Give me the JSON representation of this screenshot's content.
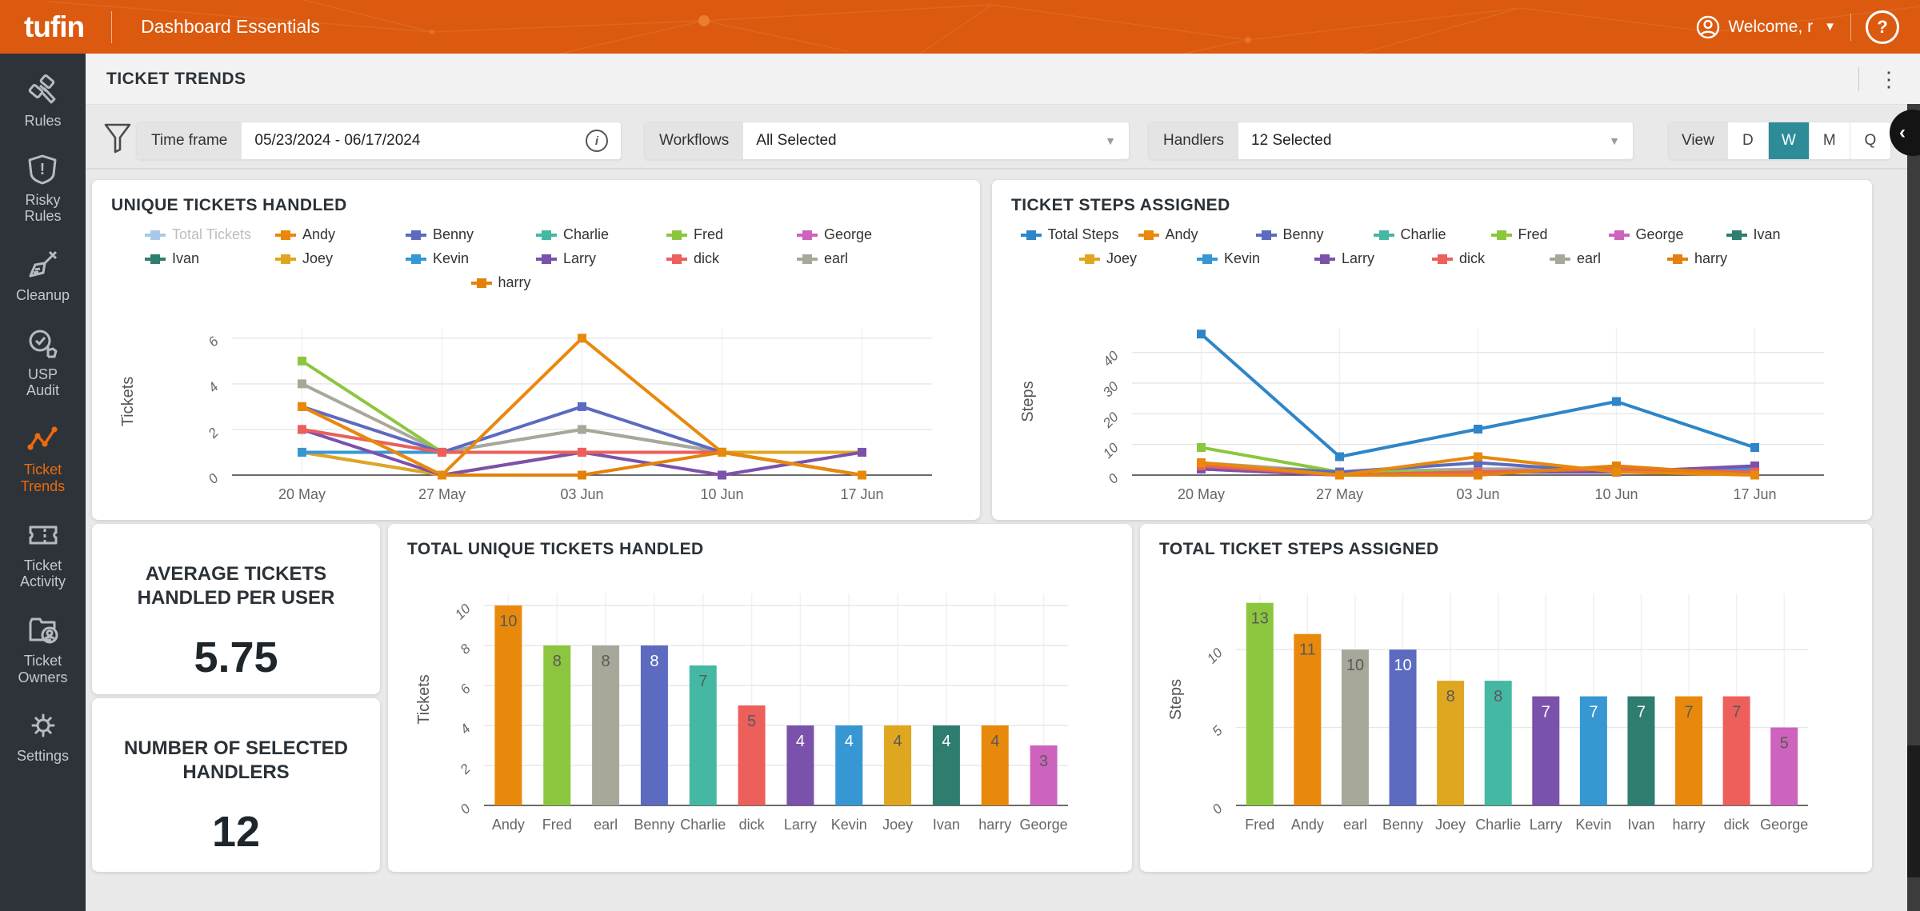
{
  "header": {
    "logo": "tufin",
    "title": "Dashboard Essentials",
    "welcome": "Welcome, r",
    "help": "?"
  },
  "sidebar": {
    "items": [
      {
        "label": "Rules",
        "icon": "gavel-icon",
        "active": false
      },
      {
        "label": "Risky Rules",
        "icon": "shield-alert-icon",
        "active": false
      },
      {
        "label": "Cleanup",
        "icon": "broom-icon",
        "active": false
      },
      {
        "label": "USP Audit",
        "icon": "audit-badge-icon",
        "active": false
      },
      {
        "label": "Ticket Trends",
        "icon": "trend-line-icon",
        "active": true
      },
      {
        "label": "Ticket Activity",
        "icon": "ticket-icon",
        "active": false
      },
      {
        "label": "Ticket Owners",
        "icon": "folder-user-icon",
        "active": false
      },
      {
        "label": "Settings",
        "icon": "gear-icon",
        "active": false
      }
    ]
  },
  "page": {
    "title": "TICKET TRENDS"
  },
  "filters": {
    "time_frame": {
      "label": "Time frame",
      "value": "05/23/2024 - 06/17/2024"
    },
    "workflows": {
      "label": "Workflows",
      "value": "All Selected"
    },
    "handlers": {
      "label": "Handlers",
      "value": "12 Selected"
    },
    "view": {
      "label": "View",
      "options": [
        "D",
        "W",
        "M",
        "Q"
      ],
      "selected": "W"
    }
  },
  "stats": [
    {
      "title": "AVERAGE TICKETS HANDLED PER USER",
      "value": "5.75"
    },
    {
      "title": "NUMBER OF SELECTED HANDLERS",
      "value": "12"
    }
  ],
  "colors": {
    "header_orange": "#DB5A0F",
    "sidebar_bg": "#2D3339",
    "active_orange": "#ED6A0C",
    "view_selected_teal": "#2E8C99",
    "card_bg": "#FFFFFF",
    "page_bg": "#E9E9E9"
  },
  "chart_data": [
    {
      "type": "line",
      "key": "unique_tickets",
      "title": "UNIQUE TICKETS HANDLED",
      "xlabel": "",
      "ylabel": "Tickets",
      "categories": [
        "20 May",
        "27 May",
        "03 Jun",
        "10 Jun",
        "17 Jun"
      ],
      "yticks": [
        0,
        2,
        4,
        6
      ],
      "ylim": [
        0,
        6.45
      ],
      "grid": true,
      "legend_position": "top",
      "note": "per-week values estimated from pixels; weekly sums match totals bar chart",
      "series": [
        {
          "name": "Total Tickets",
          "color": "#A9C9E8",
          "dim": true,
          "values": null,
          "z": 0
        },
        {
          "name": "Andy",
          "color": "#E8890C",
          "values": [
            3,
            0,
            6,
            1,
            0
          ],
          "z": 20
        },
        {
          "name": "Benny",
          "color": "#5C6BC0",
          "values": [
            3,
            1,
            3,
            1,
            0
          ],
          "z": 16
        },
        {
          "name": "Charlie",
          "color": "#45B8A4",
          "values": [
            2,
            1,
            2,
            1,
            1
          ],
          "z": 5
        },
        {
          "name": "Fred",
          "color": "#8CC63E",
          "values": [
            5,
            1,
            1,
            1,
            0
          ],
          "z": 14
        },
        {
          "name": "George",
          "color": "#CE63BE",
          "values": [
            1,
            0,
            1,
            1,
            0
          ],
          "z": 3
        },
        {
          "name": "Ivan",
          "color": "#2E7D6E",
          "values": [
            1,
            1,
            1,
            1,
            0
          ],
          "z": 4
        },
        {
          "name": "Joey",
          "color": "#DFA620",
          "values": [
            1,
            0,
            1,
            1,
            1
          ],
          "z": 6
        },
        {
          "name": "Kevin",
          "color": "#3797D3",
          "values": [
            1,
            1,
            1,
            1,
            0
          ],
          "z": 7
        },
        {
          "name": "Larry",
          "color": "#7B52AB",
          "values": [
            2,
            0,
            1,
            0,
            1
          ],
          "z": 15
        },
        {
          "name": "dick",
          "color": "#EC5F5A",
          "values": [
            2,
            1,
            1,
            1,
            0
          ],
          "z": 18
        },
        {
          "name": "earl",
          "color": "#A8A89A",
          "values": [
            4,
            1,
            2,
            1,
            0
          ],
          "z": 13
        },
        {
          "name": "harry",
          "color": "#E2820B",
          "values": [
            3,
            0,
            0,
            1,
            0
          ],
          "z": 19
        }
      ]
    },
    {
      "type": "line",
      "key": "ticket_steps",
      "title": "TICKET STEPS ASSIGNED",
      "xlabel": "",
      "ylabel": "Steps",
      "categories": [
        "20 May",
        "27 May",
        "03 Jun",
        "10 Jun",
        "17 Jun"
      ],
      "yticks": [
        0,
        10,
        20,
        30,
        40
      ],
      "ylim": [
        0,
        48
      ],
      "grid": true,
      "legend_position": "top",
      "note": "per-week values estimated from pixels; weekly sums match totals bar chart",
      "series": [
        {
          "name": "Total Steps",
          "color": "#2E86C8",
          "values": [
            46,
            6,
            15,
            24,
            9
          ],
          "z": 30
        },
        {
          "name": "Andy",
          "color": "#E8890C",
          "values": [
            4,
            0,
            6,
            1,
            0
          ],
          "z": 20
        },
        {
          "name": "Benny",
          "color": "#5C6BC0",
          "values": [
            3,
            1,
            4,
            1,
            1
          ],
          "z": 16
        },
        {
          "name": "Charlie",
          "color": "#45B8A4",
          "values": [
            3,
            1,
            1,
            2,
            1
          ],
          "z": 5
        },
        {
          "name": "Fred",
          "color": "#8CC63E",
          "values": [
            9,
            1,
            1,
            1,
            1
          ],
          "z": 14
        },
        {
          "name": "George",
          "color": "#CE63BE",
          "values": [
            2,
            0,
            1,
            1,
            1
          ],
          "z": 3
        },
        {
          "name": "Ivan",
          "color": "#2E7D6E",
          "values": [
            2,
            1,
            1,
            2,
            1
          ],
          "z": 4
        },
        {
          "name": "Joey",
          "color": "#DFA620",
          "values": [
            4,
            0,
            1,
            2,
            1
          ],
          "z": 6
        },
        {
          "name": "Kevin",
          "color": "#3797D3",
          "values": [
            2,
            1,
            1,
            1,
            2
          ],
          "z": 7
        },
        {
          "name": "Larry",
          "color": "#7B52AB",
          "values": [
            2,
            0,
            1,
            1,
            3
          ],
          "z": 17
        },
        {
          "name": "dick",
          "color": "#EC5F5A",
          "values": [
            3,
            0,
            1,
            2,
            1
          ],
          "z": 18
        },
        {
          "name": "earl",
          "color": "#A8A89A",
          "values": [
            4,
            1,
            2,
            2,
            1
          ],
          "z": 13
        },
        {
          "name": "harry",
          "color": "#E2820B",
          "values": [
            4,
            0,
            0,
            3,
            0
          ],
          "z": 19
        }
      ]
    },
    {
      "type": "bar",
      "key": "total_unique_tickets",
      "title": "TOTAL UNIQUE TICKETS HANDLED",
      "xlabel": "",
      "ylabel": "Tickets",
      "yticks": [
        0,
        2,
        4,
        6,
        8,
        10
      ],
      "ylim": [
        0,
        10.6
      ],
      "grid": true,
      "categories": [
        "Andy",
        "Fred",
        "earl",
        "Benny",
        "Charlie",
        "dick",
        "Larry",
        "Kevin",
        "Joey",
        "Ivan",
        "harry",
        "George"
      ],
      "values": [
        10,
        8,
        8,
        8,
        7,
        5,
        4,
        4,
        4,
        4,
        4,
        3
      ],
      "bar_colors": [
        "#E8890C",
        "#8CC63E",
        "#A8A89A",
        "#5C6BC0",
        "#45B8A4",
        "#EC5F5A",
        "#7B52AB",
        "#3797D3",
        "#DFA620",
        "#2E7D6E",
        "#E8890C",
        "#CE63BE"
      ],
      "label_white": [
        false,
        false,
        false,
        true,
        false,
        false,
        true,
        true,
        false,
        true,
        false,
        false
      ]
    },
    {
      "type": "bar",
      "key": "total_ticket_steps",
      "title": "TOTAL TICKET STEPS ASSIGNED",
      "xlabel": "",
      "ylabel": "Steps",
      "yticks": [
        0,
        5,
        10
      ],
      "ylim": [
        0,
        13.6
      ],
      "grid": true,
      "categories": [
        "Fred",
        "Andy",
        "earl",
        "Benny",
        "Joey",
        "Charlie",
        "Larry",
        "Kevin",
        "Ivan",
        "harry",
        "dick",
        "George"
      ],
      "values": [
        13,
        11,
        10,
        10,
        8,
        8,
        7,
        7,
        7,
        7,
        7,
        5
      ],
      "bar_colors": [
        "#8CC63E",
        "#E8890C",
        "#A8A89A",
        "#5C6BC0",
        "#DFA620",
        "#45B8A4",
        "#7B52AB",
        "#3797D3",
        "#2E7D6E",
        "#E8890C",
        "#EC5F5A",
        "#CE63BE"
      ],
      "label_white": [
        false,
        false,
        false,
        true,
        false,
        false,
        true,
        true,
        true,
        false,
        false,
        false
      ]
    }
  ]
}
